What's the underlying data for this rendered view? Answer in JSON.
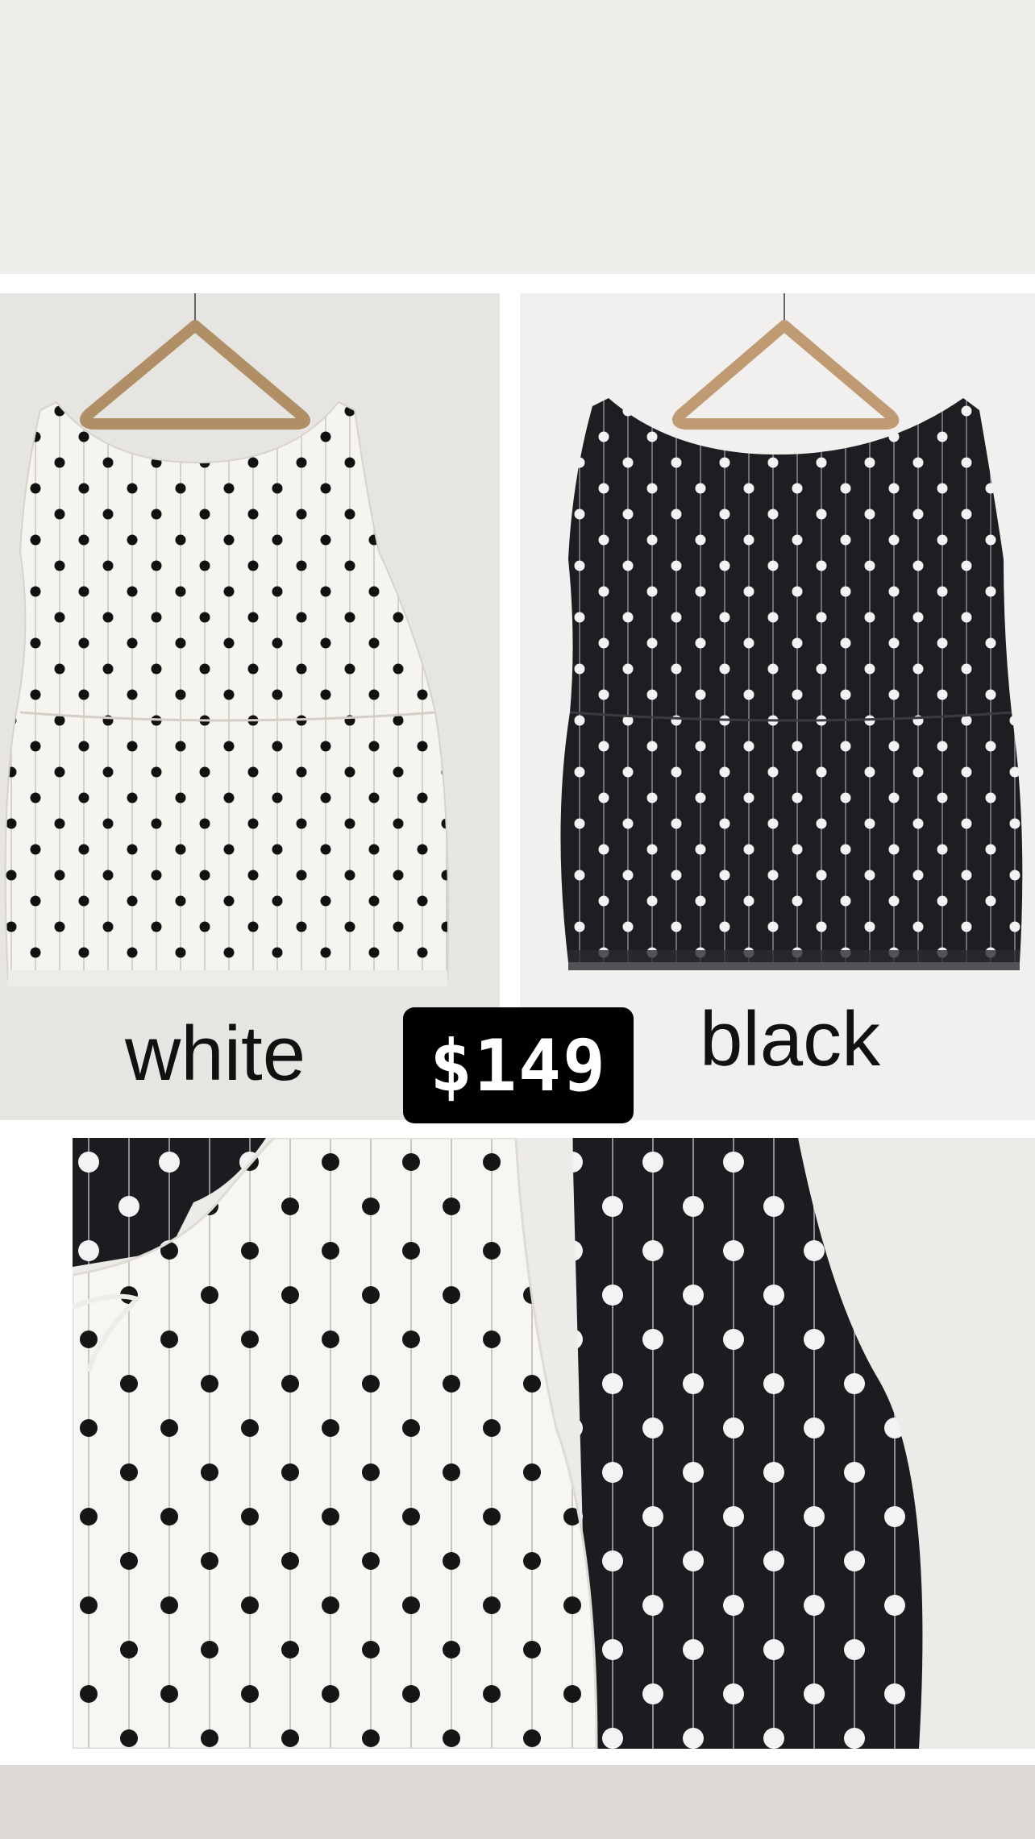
{
  "products": {
    "white": {
      "label": "white",
      "garment_color": "#f6f4ef",
      "dot_color": "#111111"
    },
    "black": {
      "label": "black",
      "garment_color": "#1d1d22",
      "dot_color": "#f2f2f2"
    }
  },
  "price": "$149",
  "colors": {
    "background": "#ffffff",
    "top_band": "#efeeeb",
    "bottom_band": "#dcd9d4",
    "price_badge_bg": "#000000",
    "price_text": "#ffffff"
  }
}
